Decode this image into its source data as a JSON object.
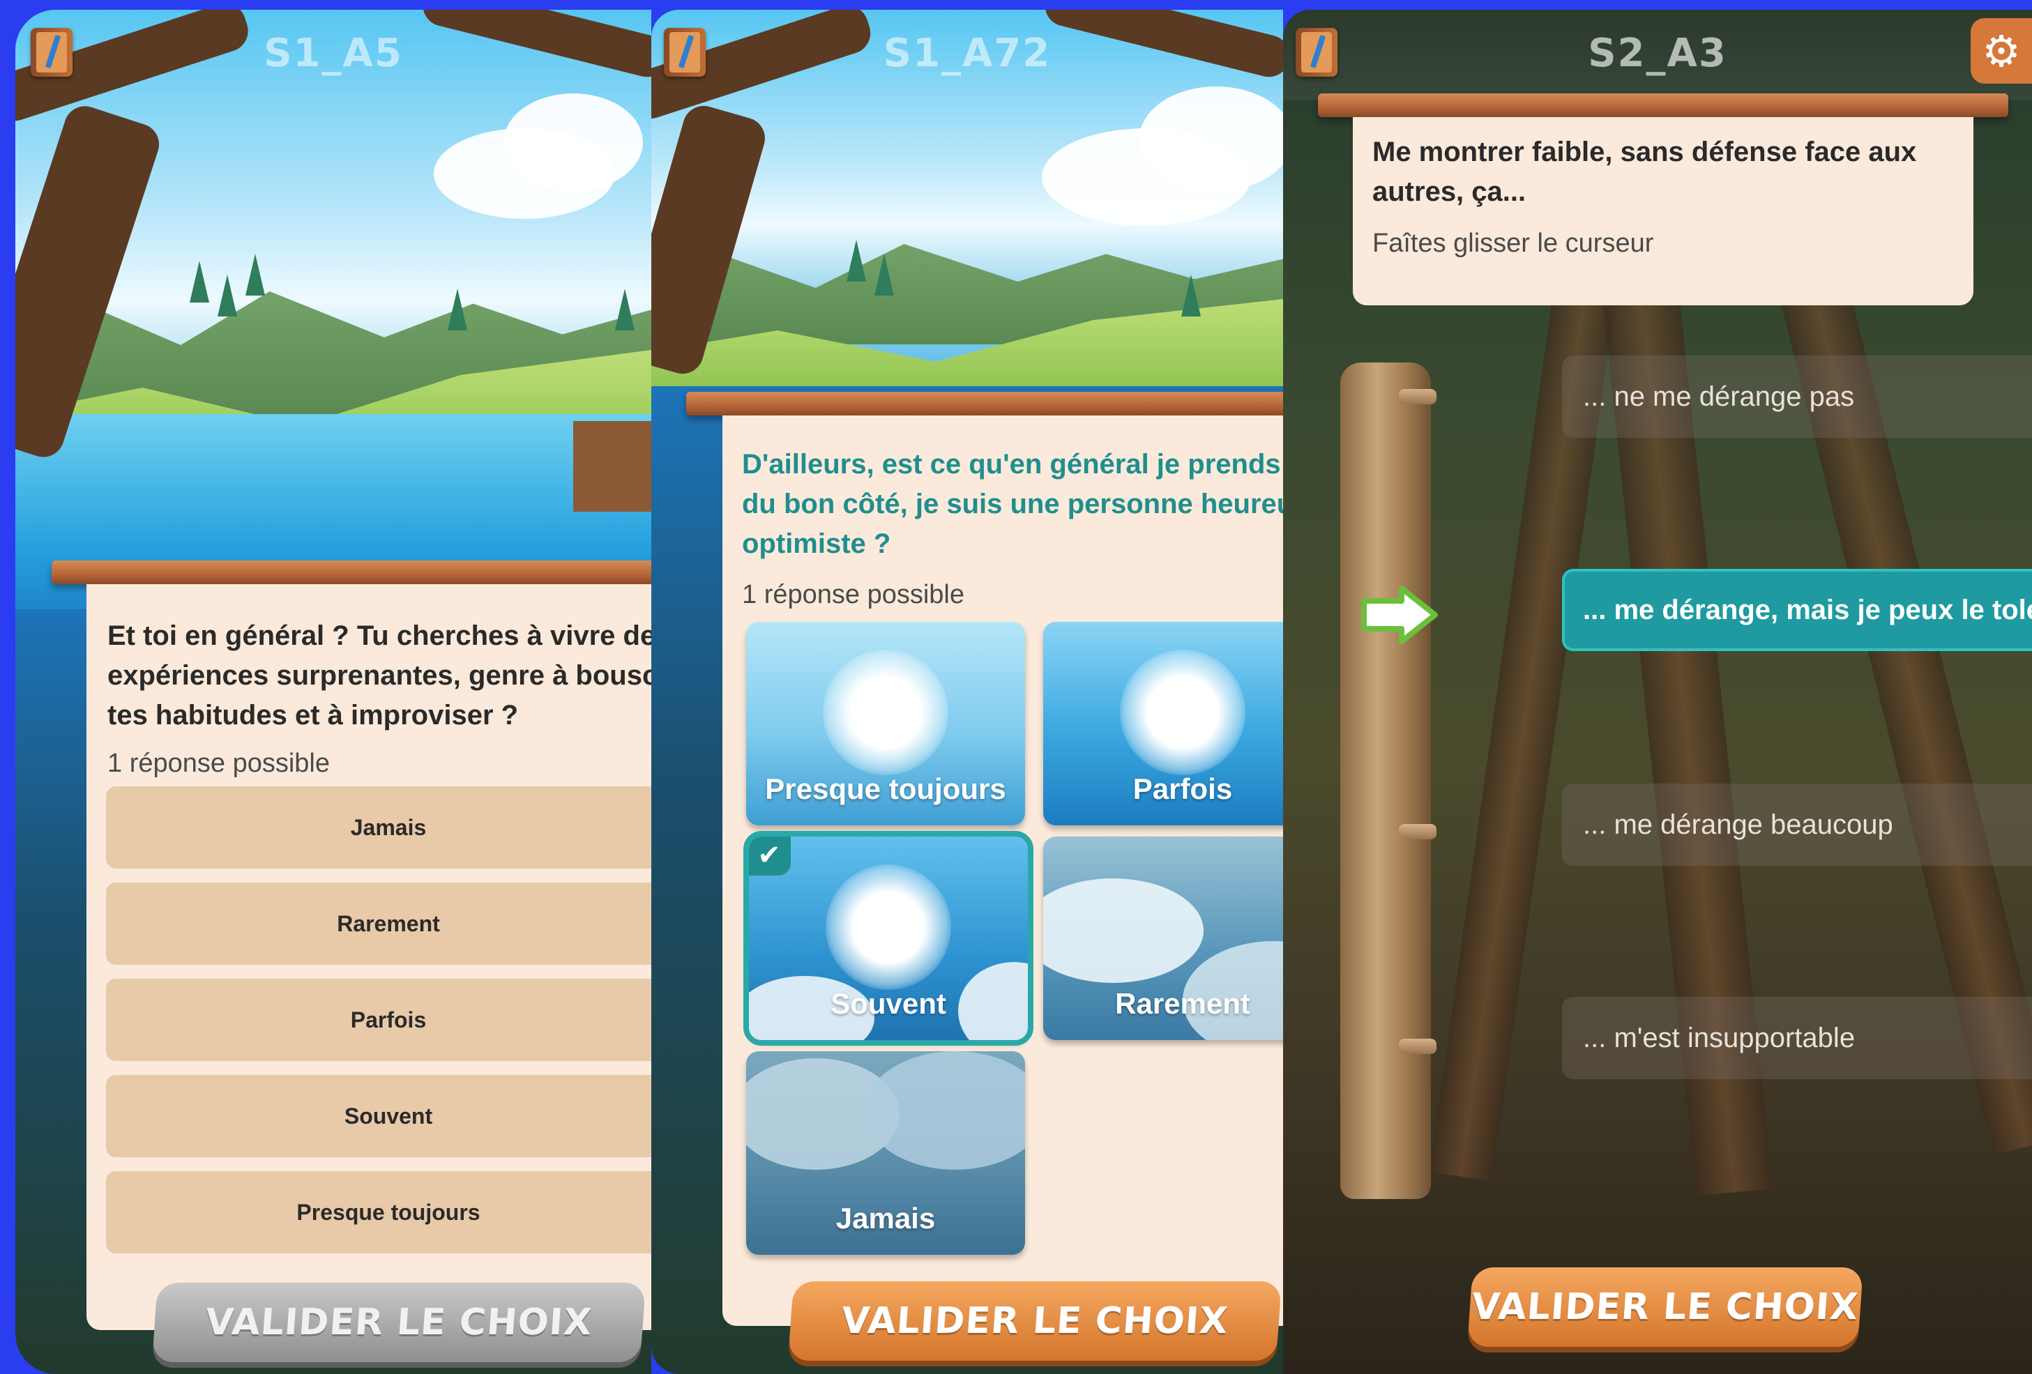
{
  "screens": [
    {
      "title": "S1_A5",
      "question": "Et toi en général ? Tu cherches à vivre des expériences surprenantes, genre à bousculer tes habitudes et à improviser ?",
      "question_lines": [
        "Et toi en général ? Tu cherches à vivre des",
        "expériences surprenantes, genre à bousculer",
        "tes habitudes et à improviser ?"
      ],
      "hint": "1 réponse possible",
      "options": [
        "Jamais",
        "Rarement",
        "Parfois",
        "Souvent",
        "Presque toujours"
      ],
      "validate_label": "VALIDER LE CHOIX",
      "validate_state": "disabled"
    },
    {
      "title": "S1_A72",
      "question_lines": [
        "D'ailleurs, est ce qu'en général je prends la vie",
        "du bon côté, je suis une personne heureuse et",
        "optimiste ?"
      ],
      "hint": "1 réponse possible",
      "tiles": [
        {
          "label": "Presque toujours",
          "weather": "sunny",
          "selected": false
        },
        {
          "label": "Parfois",
          "weather": "sunny",
          "selected": false
        },
        {
          "label": "Souvent",
          "weather": "partly-cloudy",
          "selected": true
        },
        {
          "label": "Rarement",
          "weather": "cloudy",
          "selected": false
        },
        {
          "label": "Jamais",
          "weather": "overcast",
          "selected": false
        }
      ],
      "check_icon": "check-icon",
      "validate_label": "VALIDER LE CHOIX",
      "validate_state": "active"
    },
    {
      "title": "S2_A3",
      "question_lines": [
        "Me montrer faible, sans défense face aux",
        "autres, ça..."
      ],
      "hint": "Faîtes glisser le curseur",
      "slider_options": [
        "... ne me dérange pas",
        "... me dérange, mais je peux le tolérer",
        "... me dérange beaucoup",
        "... m'est insupportable"
      ],
      "slider_selected_index": 1,
      "settings_icon": "gear-icon",
      "validate_label": "VALIDER LE CHOIX",
      "validate_state": "active"
    }
  ],
  "colors": {
    "frame": "#2b3df0",
    "card": "#fbeadb",
    "option": "#e8c9a8",
    "teal_text": "#1f8e8e",
    "selected_slider": "#1f9aa0",
    "validate_orange": "#e08a3c",
    "validate_grey": "#a8a8a8"
  }
}
